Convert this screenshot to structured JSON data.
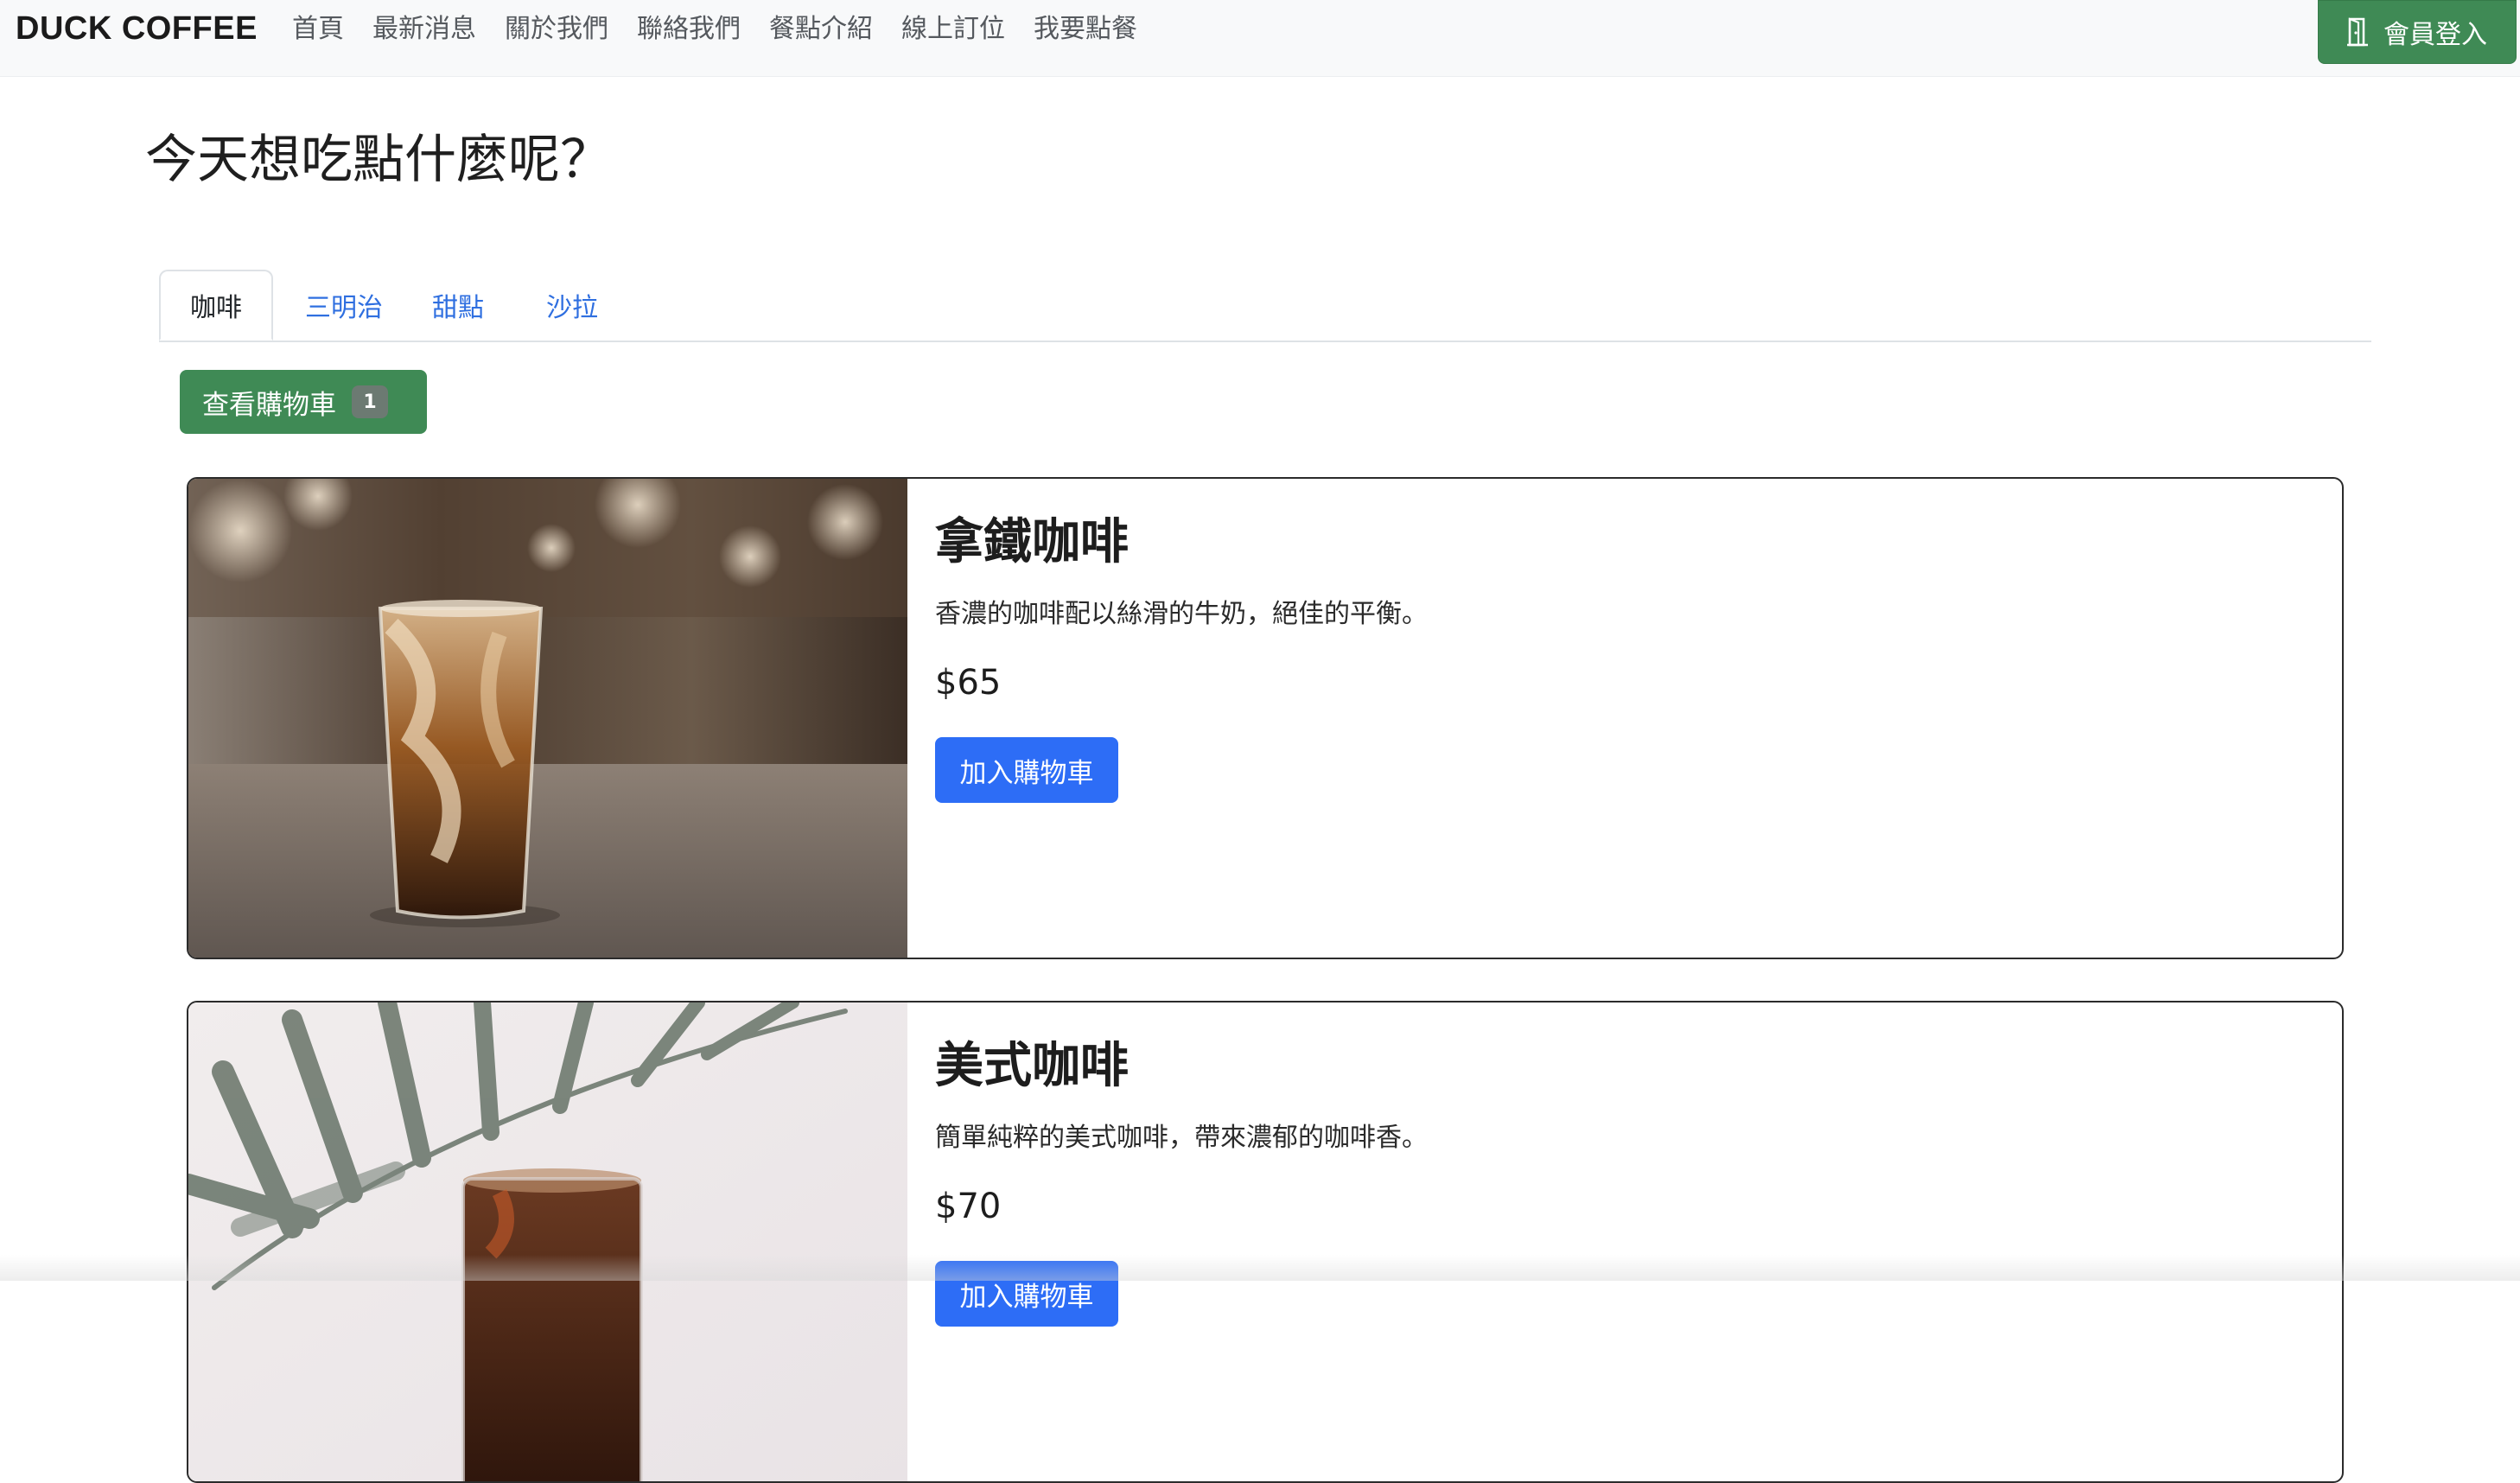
{
  "brand": "DUCK COFFEE",
  "nav": [
    "首頁",
    "最新消息",
    "關於我們",
    "聯絡我們",
    "餐點介紹",
    "線上訂位",
    "我要點餐"
  ],
  "login": {
    "label": "會員登入",
    "icon": "door-icon"
  },
  "page_title": "今天想吃點什麼呢？",
  "tabs": [
    {
      "label": "咖啡",
      "active": true
    },
    {
      "label": "三明治",
      "active": false
    },
    {
      "label": "甜點",
      "active": false
    },
    {
      "label": "沙拉",
      "active": false
    }
  ],
  "cart": {
    "label": "查看購物車",
    "count": "1"
  },
  "products": [
    {
      "name": "拿鐵咖啡",
      "description": "香濃的咖啡配以絲滑的牛奶，絕佳的平衡。",
      "price": "$65",
      "button": "加入購物車"
    },
    {
      "name": "美式咖啡",
      "description": "簡單純粹的美式咖啡，帶來濃郁的咖啡香。",
      "price": "$70",
      "button": "加入購物車"
    }
  ],
  "colors": {
    "accent_green": "#3f8a55",
    "primary_blue": "#2d6df6",
    "tab_link_blue": "#2f6fe0",
    "navbar_bg": "#f8f9fa"
  }
}
